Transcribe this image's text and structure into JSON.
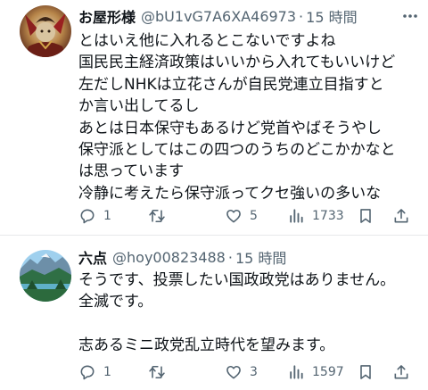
{
  "posts": [
    {
      "display_name": "お屋形様",
      "handle": "@bU1vG7A6XA46973",
      "separator": "·",
      "time": "15 時間",
      "lines": [
        "とはいえ他に入れるとこないですよね",
        "国民民主経済政策はいいから入れてもいいけど",
        "左だしNHKは立花さんが自民党連立目指すと",
        "か言い出してるし",
        "あとは日本保守もあるけど党首やばそうやし",
        "保守派としてはこの四つのうちのどこかかなと",
        "は思っています",
        "冷静に考えたら保守派ってクセ強いの多いな"
      ],
      "replies": "1",
      "reposts": "",
      "likes": "5",
      "views": "1733",
      "icons": [
        "reply-icon",
        "repost-icon",
        "like-icon",
        "views-icon",
        "bookmark-icon",
        "share-icon"
      ]
    },
    {
      "display_name": "六点",
      "handle": "@hoy00823488",
      "separator": "·",
      "time": "15 時間",
      "lines": [
        "そうです、投票したい国政政党はありません。",
        "全滅です。",
        "",
        "志あるミニ政党乱立時代を望みます。"
      ],
      "replies": "1",
      "reposts": "",
      "likes": "3",
      "views": "1597",
      "icons": [
        "reply-icon",
        "repost-icon",
        "like-icon",
        "views-icon",
        "bookmark-icon",
        "share-icon"
      ]
    }
  ],
  "colors": {
    "text": "#0f1419",
    "secondary": "#536471",
    "divider": "#e7e9ea"
  }
}
